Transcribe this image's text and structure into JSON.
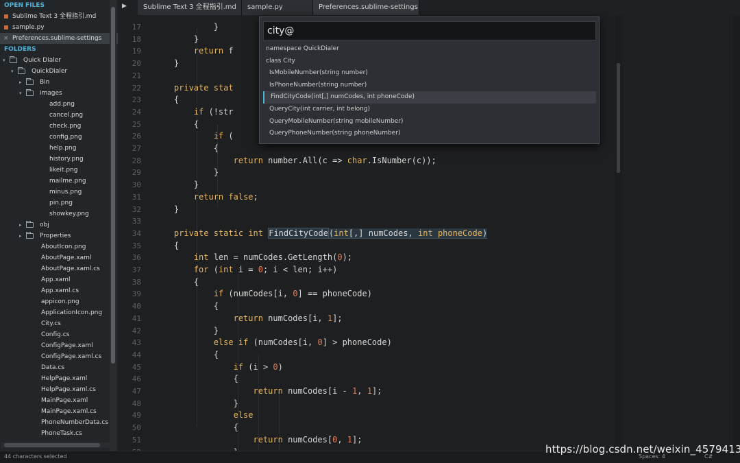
{
  "sidebar": {
    "open_files_header": "OPEN FILES",
    "open_files": [
      {
        "label": "Sublime Text 3 全程指引.md",
        "marker": "dot"
      },
      {
        "label": "sample.py",
        "marker": "dot"
      },
      {
        "label": "Preferences.sublime-settings",
        "marker": "close",
        "close_glyph": "×"
      }
    ],
    "folders_header": "FOLDERS",
    "tree": [
      {
        "label": "Quick Dialer",
        "type": "folder",
        "depth": 0,
        "open": true
      },
      {
        "label": "QuickDialer",
        "type": "folder",
        "depth": 1,
        "open": true
      },
      {
        "label": "Bin",
        "type": "folder",
        "depth": 2,
        "open": false
      },
      {
        "label": "images",
        "type": "folder",
        "depth": 2,
        "open": true
      },
      {
        "label": "add.png",
        "type": "file",
        "depth": 3
      },
      {
        "label": "cancel.png",
        "type": "file",
        "depth": 3
      },
      {
        "label": "check.png",
        "type": "file",
        "depth": 3
      },
      {
        "label": "config.png",
        "type": "file",
        "depth": 3
      },
      {
        "label": "help.png",
        "type": "file",
        "depth": 3
      },
      {
        "label": "history.png",
        "type": "file",
        "depth": 3
      },
      {
        "label": "likeit.png",
        "type": "file",
        "depth": 3
      },
      {
        "label": "mailme.png",
        "type": "file",
        "depth": 3
      },
      {
        "label": "minus.png",
        "type": "file",
        "depth": 3
      },
      {
        "label": "pin.png",
        "type": "file",
        "depth": 3
      },
      {
        "label": "showkey.png",
        "type": "file",
        "depth": 3
      },
      {
        "label": "obj",
        "type": "folder",
        "depth": 2,
        "open": false
      },
      {
        "label": "Properties",
        "type": "folder",
        "depth": 2,
        "open": false
      },
      {
        "label": "AboutIcon.png",
        "type": "file",
        "depth": 2
      },
      {
        "label": "AboutPage.xaml",
        "type": "file",
        "depth": 2
      },
      {
        "label": "AboutPage.xaml.cs",
        "type": "file",
        "depth": 2
      },
      {
        "label": "App.xaml",
        "type": "file",
        "depth": 2
      },
      {
        "label": "App.xaml.cs",
        "type": "file",
        "depth": 2
      },
      {
        "label": "appicon.png",
        "type": "file",
        "depth": 2
      },
      {
        "label": "ApplicationIcon.png",
        "type": "file",
        "depth": 2
      },
      {
        "label": "City.cs",
        "type": "file",
        "depth": 2
      },
      {
        "label": "Config.cs",
        "type": "file",
        "depth": 2
      },
      {
        "label": "ConfigPage.xaml",
        "type": "file",
        "depth": 2
      },
      {
        "label": "ConfigPage.xaml.cs",
        "type": "file",
        "depth": 2
      },
      {
        "label": "Data.cs",
        "type": "file",
        "depth": 2
      },
      {
        "label": "HelpPage.xaml",
        "type": "file",
        "depth": 2
      },
      {
        "label": "HelpPage.xaml.cs",
        "type": "file",
        "depth": 2
      },
      {
        "label": "MainPage.xaml",
        "type": "file",
        "depth": 2
      },
      {
        "label": "MainPage.xaml.cs",
        "type": "file",
        "depth": 2
      },
      {
        "label": "PhoneNumberData.cs",
        "type": "file",
        "depth": 2
      },
      {
        "label": "PhoneTask.cs",
        "type": "file",
        "depth": 2
      }
    ]
  },
  "tabbar": {
    "arrow": "▶",
    "tabs": [
      {
        "label": "Sublime Text 3 全程指引.md",
        "active": false
      },
      {
        "label": "sample.py",
        "active": false
      },
      {
        "label": "Preferences.sublime-settings",
        "active": true
      }
    ]
  },
  "editor": {
    "lines": [
      {
        "n": "17",
        "tokens": [
          [
            "            ",
            ""
          ],
          [
            "}",
            ""
          ]
        ]
      },
      {
        "n": "18",
        "tokens": [
          [
            "        ",
            ""
          ],
          [
            "}",
            ""
          ]
        ]
      },
      {
        "n": "19",
        "tokens": [
          [
            "        ",
            ""
          ],
          [
            "return",
            "kw"
          ],
          [
            " f",
            ""
          ]
        ]
      },
      {
        "n": "20",
        "tokens": [
          [
            "    ",
            ""
          ],
          [
            "}",
            ""
          ]
        ]
      },
      {
        "n": "21",
        "tokens": []
      },
      {
        "n": "22",
        "tokens": [
          [
            "    ",
            ""
          ],
          [
            "private",
            "kw"
          ],
          [
            " ",
            ""
          ],
          [
            "stat",
            "kw"
          ]
        ]
      },
      {
        "n": "23",
        "tokens": [
          [
            "    ",
            ""
          ],
          [
            "{",
            ""
          ]
        ]
      },
      {
        "n": "24",
        "tokens": [
          [
            "        ",
            ""
          ],
          [
            "if",
            "kw"
          ],
          [
            " (!str",
            ""
          ]
        ]
      },
      {
        "n": "25",
        "tokens": [
          [
            "        ",
            ""
          ],
          [
            "{",
            ""
          ]
        ]
      },
      {
        "n": "26",
        "tokens": [
          [
            "            ",
            ""
          ],
          [
            "if",
            "kw"
          ],
          [
            " (",
            ""
          ]
        ]
      },
      {
        "n": "27",
        "tokens": [
          [
            "            ",
            ""
          ],
          [
            "{",
            ""
          ]
        ]
      },
      {
        "n": "28",
        "tokens": [
          [
            "                ",
            ""
          ],
          [
            "return",
            "kw"
          ],
          [
            " number.All(c => ",
            ""
          ],
          [
            "char",
            "kw"
          ],
          [
            ".IsNumber(c));",
            ""
          ]
        ]
      },
      {
        "n": "29",
        "tokens": [
          [
            "            ",
            ""
          ],
          [
            "}",
            ""
          ]
        ]
      },
      {
        "n": "30",
        "tokens": [
          [
            "        ",
            ""
          ],
          [
            "}",
            ""
          ]
        ]
      },
      {
        "n": "31",
        "tokens": [
          [
            "        ",
            ""
          ],
          [
            "return",
            "kw"
          ],
          [
            " ",
            ""
          ],
          [
            "false",
            "kw"
          ],
          [
            ";",
            ""
          ]
        ]
      },
      {
        "n": "32",
        "tokens": [
          [
            "    ",
            ""
          ],
          [
            "}",
            ""
          ]
        ]
      },
      {
        "n": "33",
        "tokens": []
      },
      {
        "n": "34",
        "tokens": [
          [
            "    ",
            ""
          ],
          [
            "private",
            "kw"
          ],
          [
            " ",
            ""
          ],
          [
            "static",
            "kw"
          ],
          [
            " ",
            ""
          ],
          [
            "int",
            "kw"
          ],
          [
            " ",
            ""
          ],
          [
            "FindCityCode",
            "hl"
          ],
          [
            "(",
            "hl2"
          ],
          [
            "int",
            "kw hl2"
          ],
          [
            "[,] numCodes, ",
            "hl2"
          ],
          [
            "int",
            "kw hl2"
          ],
          [
            " ",
            "hl2"
          ],
          [
            "phoneCode",
            "kw hl2"
          ],
          [
            ")",
            "hl2"
          ]
        ]
      },
      {
        "n": "35",
        "tokens": [
          [
            "    ",
            ""
          ],
          [
            "{",
            ""
          ]
        ]
      },
      {
        "n": "36",
        "tokens": [
          [
            "        ",
            ""
          ],
          [
            "int",
            "kw"
          ],
          [
            " len = numCodes.GetLength(",
            ""
          ],
          [
            "0",
            "num"
          ],
          [
            ");",
            ""
          ]
        ]
      },
      {
        "n": "37",
        "tokens": [
          [
            "        ",
            ""
          ],
          [
            "for",
            "kw"
          ],
          [
            " (",
            ""
          ],
          [
            "int",
            "kw"
          ],
          [
            " i = ",
            ""
          ],
          [
            "0",
            "num"
          ],
          [
            "; i < len; i++)",
            ""
          ]
        ]
      },
      {
        "n": "38",
        "tokens": [
          [
            "        ",
            ""
          ],
          [
            "{",
            ""
          ]
        ]
      },
      {
        "n": "39",
        "tokens": [
          [
            "            ",
            ""
          ],
          [
            "if",
            "kw"
          ],
          [
            " (numCodes[i, ",
            ""
          ],
          [
            "0",
            "num"
          ],
          [
            "] == phoneCode)",
            ""
          ]
        ]
      },
      {
        "n": "40",
        "tokens": [
          [
            "            ",
            ""
          ],
          [
            "{",
            ""
          ]
        ]
      },
      {
        "n": "41",
        "tokens": [
          [
            "                ",
            ""
          ],
          [
            "return",
            "kw"
          ],
          [
            " numCodes[i, ",
            ""
          ],
          [
            "1",
            "num"
          ],
          [
            "];",
            ""
          ]
        ]
      },
      {
        "n": "42",
        "tokens": [
          [
            "            ",
            ""
          ],
          [
            "}",
            ""
          ]
        ]
      },
      {
        "n": "43",
        "tokens": [
          [
            "            ",
            ""
          ],
          [
            "else",
            "kw"
          ],
          [
            " ",
            ""
          ],
          [
            "if",
            "kw"
          ],
          [
            " (numCodes[i, ",
            ""
          ],
          [
            "0",
            "num"
          ],
          [
            "] > phoneCode)",
            ""
          ]
        ]
      },
      {
        "n": "44",
        "tokens": [
          [
            "            ",
            ""
          ],
          [
            "{",
            ""
          ]
        ]
      },
      {
        "n": "45",
        "tokens": [
          [
            "                ",
            ""
          ],
          [
            "if",
            "kw"
          ],
          [
            " (i > ",
            ""
          ],
          [
            "0",
            "num"
          ],
          [
            ")",
            ""
          ]
        ]
      },
      {
        "n": "46",
        "tokens": [
          [
            "                ",
            ""
          ],
          [
            "{",
            ""
          ]
        ]
      },
      {
        "n": "47",
        "tokens": [
          [
            "                    ",
            ""
          ],
          [
            "return",
            "kw"
          ],
          [
            " numCodes[i - ",
            ""
          ],
          [
            "1",
            "num"
          ],
          [
            ", ",
            ""
          ],
          [
            "1",
            "num"
          ],
          [
            "];",
            ""
          ]
        ]
      },
      {
        "n": "48",
        "tokens": [
          [
            "                ",
            ""
          ],
          [
            "}",
            ""
          ]
        ]
      },
      {
        "n": "49",
        "tokens": [
          [
            "                ",
            ""
          ],
          [
            "else",
            "kw"
          ]
        ]
      },
      {
        "n": "50",
        "tokens": [
          [
            "                ",
            ""
          ],
          [
            "{",
            ""
          ]
        ]
      },
      {
        "n": "51",
        "tokens": [
          [
            "                    ",
            ""
          ],
          [
            "return",
            "kw"
          ],
          [
            " numCodes[",
            ""
          ],
          [
            "0",
            "num"
          ],
          [
            ", ",
            ""
          ],
          [
            "1",
            "num"
          ],
          [
            "];",
            ""
          ]
        ]
      },
      {
        "n": "52",
        "tokens": [
          [
            "                ",
            ""
          ],
          [
            "}",
            ""
          ]
        ]
      }
    ]
  },
  "goto": {
    "query": "city@",
    "results": [
      {
        "label": "namespace QuickDialer",
        "indent": 0,
        "selected": false
      },
      {
        "label": "class City",
        "indent": 0,
        "selected": false
      },
      {
        "label": "IsMobileNumber(string number)",
        "indent": 1,
        "selected": false
      },
      {
        "label": "IsPhoneNumber(string number)",
        "indent": 1,
        "selected": false
      },
      {
        "label": "FindCityCode(int[,] numCodes, int phoneCode)",
        "indent": 1,
        "selected": true
      },
      {
        "label": "QueryCity(int carrier, int belong)",
        "indent": 1,
        "selected": false
      },
      {
        "label": "QueryMobileNumber(string mobileNumber)",
        "indent": 1,
        "selected": false
      },
      {
        "label": "QueryPhoneNumber(string phoneNumber)",
        "indent": 1,
        "selected": false
      }
    ]
  },
  "statusbar": {
    "left": "44 characters selected",
    "spaces": "Spaces: 4",
    "syntax": "C#"
  },
  "watermark": "https://blog.csdn.net/weixin_45794138",
  "colors": {
    "accent": "#4fb3d9",
    "keyword": "#e6b55e",
    "number": "#e07f5b",
    "file_marker": "#c86b3c"
  }
}
